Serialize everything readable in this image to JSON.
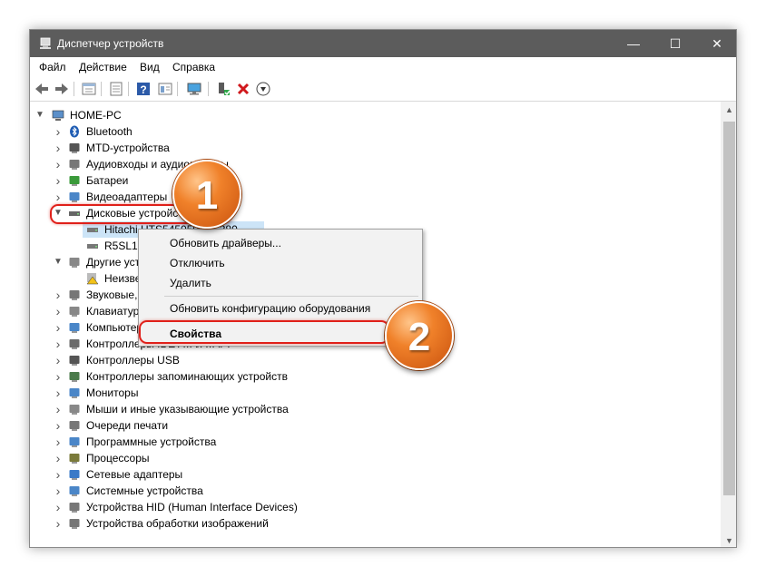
{
  "window": {
    "title": "Диспетчер устройств",
    "controls": {
      "minimize": "—",
      "maximize": "☐",
      "close": "✕"
    }
  },
  "menu": [
    "Файл",
    "Действие",
    "Вид",
    "Справка"
  ],
  "toolbar_icons": [
    "back-icon",
    "forward-icon",
    "properties-view-icon",
    "list-icon",
    "help-icon",
    "details-icon",
    "monitor-icon",
    "add-driver-icon",
    "uninstall-icon",
    "download-icon"
  ],
  "tree": {
    "root": "HOME-PC",
    "items": [
      {
        "label": "Bluetooth",
        "icon": "bluetooth-icon"
      },
      {
        "label": "MTD-устройства",
        "icon": "mtd-icon"
      },
      {
        "label": "Аудиовходы и аудиовыходы",
        "icon": "audio-icon"
      },
      {
        "label": "Батареи",
        "icon": "battery-icon"
      },
      {
        "label": "Видеоадаптеры",
        "icon": "display-adapter-icon"
      },
      {
        "label": "Дисковые устройства",
        "icon": "disk-icon",
        "expanded": true
      },
      {
        "label": "Hitachi HTS545050A7E380",
        "icon": "disk-drive-icon",
        "child": true,
        "selected": true
      },
      {
        "label": "R5SL128G",
        "icon": "disk-drive-icon",
        "child": true
      },
      {
        "label": "Другие устройства",
        "icon": "other-devices-icon",
        "expanded": true
      },
      {
        "label": "Неизвестное устройство",
        "icon": "unknown-device-icon",
        "child": true
      },
      {
        "label": "Звуковые, игровые и видеоустройства",
        "icon": "sound-icon"
      },
      {
        "label": "Клавиатуры",
        "icon": "keyboard-icon"
      },
      {
        "label": "Компьютер",
        "icon": "computer-icon"
      },
      {
        "label": "Контроллеры IDE ATA/ATAPI",
        "icon": "ide-icon"
      },
      {
        "label": "Контроллеры USB",
        "icon": "usb-icon"
      },
      {
        "label": "Контроллеры запоминающих устройств",
        "icon": "storage-controller-icon"
      },
      {
        "label": "Мониторы",
        "icon": "monitor-icon"
      },
      {
        "label": "Мыши и иные указывающие устройства",
        "icon": "mouse-icon"
      },
      {
        "label": "Очереди печати",
        "icon": "printer-icon"
      },
      {
        "label": "Программные устройства",
        "icon": "software-device-icon"
      },
      {
        "label": "Процессоры",
        "icon": "cpu-icon"
      },
      {
        "label": "Сетевые адаптеры",
        "icon": "network-icon"
      },
      {
        "label": "Системные устройства",
        "icon": "system-icon"
      },
      {
        "label": "Устройства HID (Human Interface Devices)",
        "icon": "hid-icon"
      },
      {
        "label": "Устройства обработки изображений",
        "icon": "imaging-icon"
      }
    ]
  },
  "context_menu": {
    "items": [
      "Обновить драйверы...",
      "Отключить",
      "Удалить",
      "Обновить конфигурацию оборудования",
      "Свойства"
    ]
  },
  "annotations": {
    "badge1": "1",
    "badge2": "2",
    "accent": "#e0201a",
    "badge_color": "#f0812a"
  },
  "colors": {
    "titlebar": "#5c5c5c",
    "selection": "#cce4f7"
  }
}
